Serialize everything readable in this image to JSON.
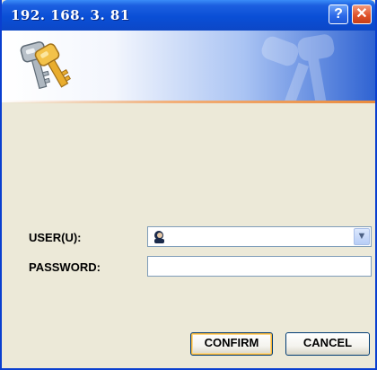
{
  "window": {
    "title": "192. 168. 3. 81"
  },
  "titlebar": {
    "help_label": "?",
    "close_label": "✕"
  },
  "form": {
    "user_label": "USER(U):",
    "password_label": "PASSWORD:",
    "user_value": "",
    "password_value": ""
  },
  "buttons": {
    "confirm": "CONFIRM",
    "cancel": "CANCEL"
  },
  "colors": {
    "titlebar": "#0a4fd6",
    "accent_line": "#e98a3c",
    "background": "#ece9d8"
  },
  "icons": {
    "banner": "keys-icon",
    "user": "user-avatar-icon",
    "dropdown": "chevron-down-icon"
  }
}
